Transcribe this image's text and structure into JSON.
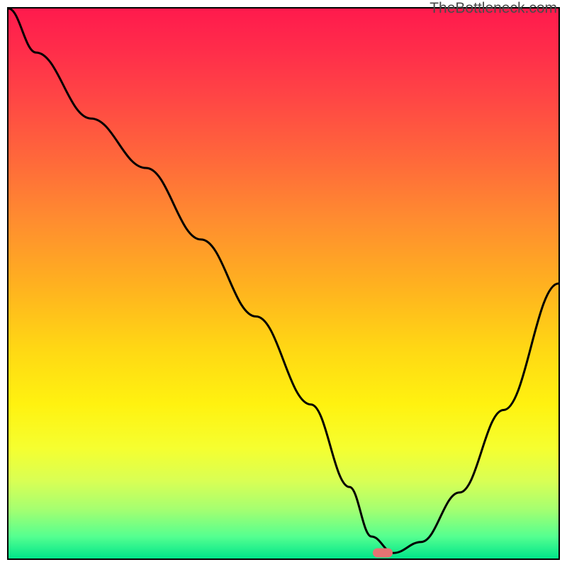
{
  "watermark": "TheBottleneck.com",
  "chart_data": {
    "type": "line",
    "title": "",
    "xlabel": "",
    "ylabel": "",
    "xlim": [
      0,
      100
    ],
    "ylim": [
      0,
      100
    ],
    "grid": false,
    "legend": false,
    "background": "gradient_red_to_green",
    "series": [
      {
        "name": "bottleneck-curve",
        "x": [
          0,
          5,
          15,
          25,
          35,
          45,
          55,
          62,
          66,
          70,
          75,
          82,
          90,
          100
        ],
        "values": [
          100,
          92,
          80,
          71,
          58,
          44,
          28,
          13,
          4,
          1,
          3,
          12,
          27,
          50
        ]
      }
    ],
    "marker": {
      "x": 68,
      "y": 1,
      "color": "#e57373",
      "shape": "pill"
    },
    "colors": {
      "top": "#ff1a4d",
      "mid": "#ffd814",
      "bottom": "#00e58a",
      "curve": "#000000",
      "marker": "#e57373"
    }
  }
}
